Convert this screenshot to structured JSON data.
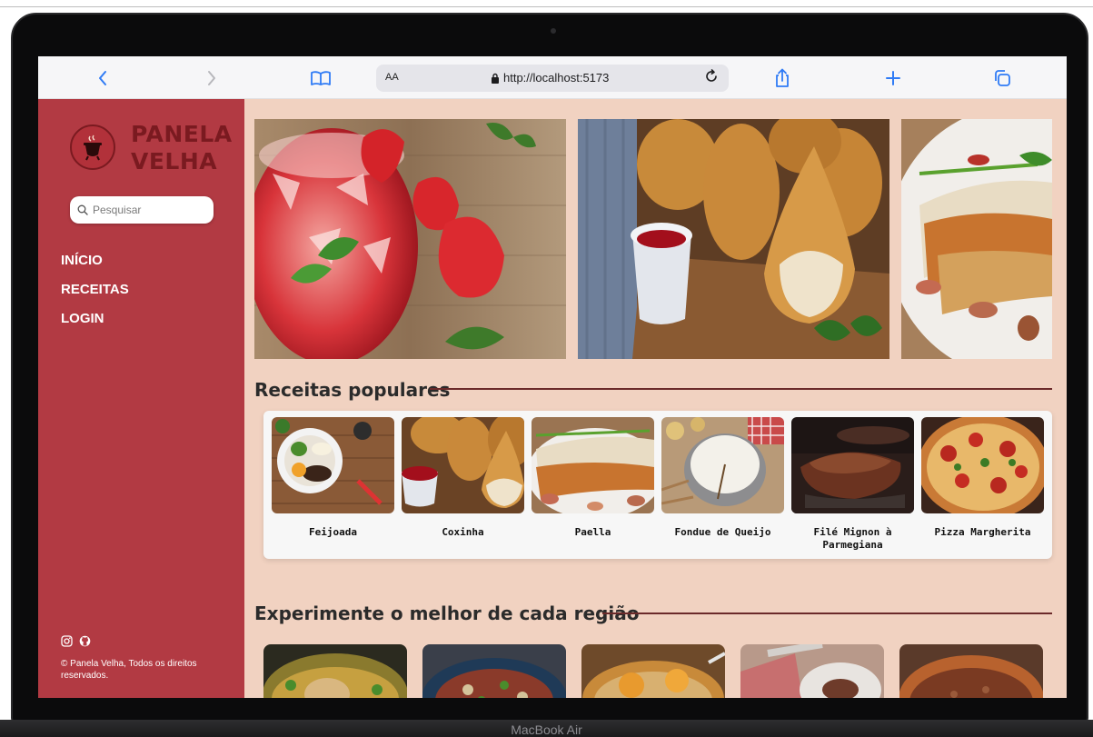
{
  "device": {
    "label": "MacBook Air"
  },
  "browser": {
    "text_size_label": "AA",
    "url": "http://localhost:5173",
    "icons": [
      "back-icon",
      "forward-icon",
      "bookmarks-icon",
      "lock-icon",
      "reload-icon",
      "share-icon",
      "new-tab-icon",
      "tabs-icon"
    ]
  },
  "sidebar": {
    "brand_line1": "PANELA",
    "brand_line2": "VELHA",
    "search_placeholder": "Pesquisar",
    "nav": [
      {
        "label": "INÍCIO"
      },
      {
        "label": "RECEITAS"
      },
      {
        "label": "LOGIN"
      }
    ],
    "social_icons": [
      "instagram-icon",
      "github-icon"
    ],
    "copyright": "© Panela Velha, Todos os direitos reservados."
  },
  "main": {
    "hero_slides": [
      "strawberry-drink",
      "coxinha",
      "sandwich"
    ],
    "popular_title": "Receitas populares",
    "popular": [
      {
        "name": "Feijoada"
      },
      {
        "name": "Coxinha"
      },
      {
        "name": "Paella"
      },
      {
        "name": "Fondue de Queijo"
      },
      {
        "name": "Filé Mignon à Parmegiana"
      },
      {
        "name": "Pizza Margherita"
      }
    ],
    "regions_title": "Experimente o melhor de cada região"
  },
  "colors": {
    "sidebar": "#b23a43",
    "main_bg": "#f1d2c1",
    "brand_text": "#7a1a20",
    "accent_blue": "#2f7bf5"
  }
}
